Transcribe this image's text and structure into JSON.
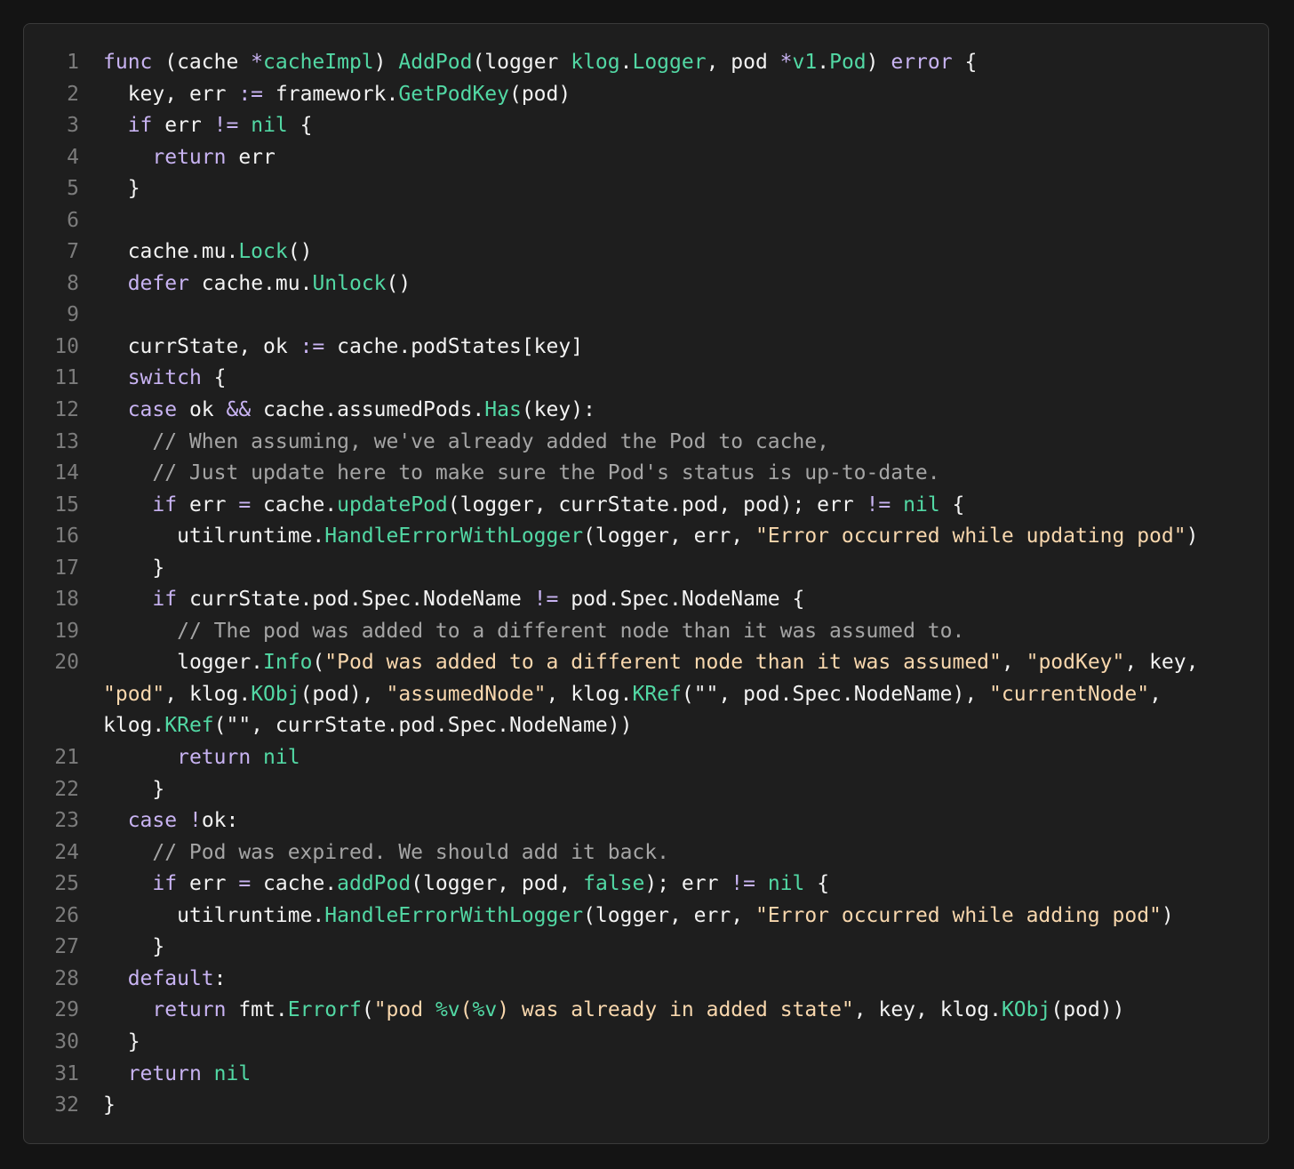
{
  "theme": {
    "background": "#141414",
    "panel_background": "#1e1e1e",
    "panel_border": "#3a3a3a",
    "line_number": "#7c7c7c",
    "plain": "#f3f3f3",
    "keyword": "#c8b3f2",
    "function": "#52d8a4",
    "string": "#f8d7ad",
    "comment": "#a5a5a5"
  },
  "code_lines": [
    {
      "number": "1",
      "tokens": [
        {
          "t": "func",
          "k": "kw"
        },
        {
          "t": " (cache "
        },
        {
          "t": "*",
          "k": "kw"
        },
        {
          "t": "cacheImpl",
          "k": "fn"
        },
        {
          "t": ") "
        },
        {
          "t": "AddPod",
          "k": "fn"
        },
        {
          "t": "(logger "
        },
        {
          "t": "klog",
          "k": "fn"
        },
        {
          "t": "."
        },
        {
          "t": "Logger",
          "k": "fn"
        },
        {
          "t": ", pod "
        },
        {
          "t": "*",
          "k": "kw"
        },
        {
          "t": "v1",
          "k": "fn"
        },
        {
          "t": "."
        },
        {
          "t": "Pod",
          "k": "fn"
        },
        {
          "t": ") "
        },
        {
          "t": "error",
          "k": "kw"
        },
        {
          "t": " {"
        }
      ]
    },
    {
      "number": "2",
      "tokens": [
        {
          "t": "  key, err "
        },
        {
          "t": ":=",
          "k": "kw"
        },
        {
          "t": " framework."
        },
        {
          "t": "GetPodKey",
          "k": "fn"
        },
        {
          "t": "(pod)"
        }
      ]
    },
    {
      "number": "3",
      "tokens": [
        {
          "t": "  "
        },
        {
          "t": "if",
          "k": "kw"
        },
        {
          "t": " err "
        },
        {
          "t": "!=",
          "k": "kw"
        },
        {
          "t": " "
        },
        {
          "t": "nil",
          "k": "fn"
        },
        {
          "t": " {"
        }
      ]
    },
    {
      "number": "4",
      "tokens": [
        {
          "t": "    "
        },
        {
          "t": "return",
          "k": "kw"
        },
        {
          "t": " err"
        }
      ]
    },
    {
      "number": "5",
      "tokens": [
        {
          "t": "  }"
        }
      ]
    },
    {
      "number": "6",
      "tokens": [
        {
          "t": ""
        }
      ]
    },
    {
      "number": "7",
      "tokens": [
        {
          "t": "  cache.mu."
        },
        {
          "t": "Lock",
          "k": "fn"
        },
        {
          "t": "()"
        }
      ]
    },
    {
      "number": "8",
      "tokens": [
        {
          "t": "  "
        },
        {
          "t": "defer",
          "k": "kw"
        },
        {
          "t": " cache.mu."
        },
        {
          "t": "Unlock",
          "k": "fn"
        },
        {
          "t": "()"
        }
      ]
    },
    {
      "number": "9",
      "tokens": [
        {
          "t": ""
        }
      ]
    },
    {
      "number": "10",
      "tokens": [
        {
          "t": "  currState, ok "
        },
        {
          "t": ":=",
          "k": "kw"
        },
        {
          "t": " cache.podStates[key]"
        }
      ]
    },
    {
      "number": "11",
      "tokens": [
        {
          "t": "  "
        },
        {
          "t": "switch",
          "k": "kw"
        },
        {
          "t": " {"
        }
      ]
    },
    {
      "number": "12",
      "tokens": [
        {
          "t": "  "
        },
        {
          "t": "case",
          "k": "kw"
        },
        {
          "t": " ok "
        },
        {
          "t": "&&",
          "k": "kw"
        },
        {
          "t": " cache.assumedPods."
        },
        {
          "t": "Has",
          "k": "fn"
        },
        {
          "t": "(key):"
        }
      ]
    },
    {
      "number": "13",
      "tokens": [
        {
          "t": "    "
        },
        {
          "t": "// When assuming, we've already added the Pod to cache,",
          "k": "cm"
        }
      ]
    },
    {
      "number": "14",
      "tokens": [
        {
          "t": "    "
        },
        {
          "t": "// Just update here to make sure the Pod's status is up-to-date.",
          "k": "cm"
        }
      ]
    },
    {
      "number": "15",
      "tokens": [
        {
          "t": "    "
        },
        {
          "t": "if",
          "k": "kw"
        },
        {
          "t": " err "
        },
        {
          "t": "=",
          "k": "kw"
        },
        {
          "t": " cache."
        },
        {
          "t": "updatePod",
          "k": "fn"
        },
        {
          "t": "(logger, currState.pod, pod); err "
        },
        {
          "t": "!=",
          "k": "kw"
        },
        {
          "t": " "
        },
        {
          "t": "nil",
          "k": "fn"
        },
        {
          "t": " {"
        }
      ]
    },
    {
      "number": "16",
      "tokens": [
        {
          "t": "      utilruntime."
        },
        {
          "t": "HandleErrorWithLogger",
          "k": "fn"
        },
        {
          "t": "(logger, err, "
        },
        {
          "t": "\"Error occurred while updating pod\"",
          "k": "str"
        },
        {
          "t": ")"
        }
      ]
    },
    {
      "number": "17",
      "tokens": [
        {
          "t": "    }"
        }
      ]
    },
    {
      "number": "18",
      "tokens": [
        {
          "t": "    "
        },
        {
          "t": "if",
          "k": "kw"
        },
        {
          "t": " currState.pod.Spec.NodeName "
        },
        {
          "t": "!=",
          "k": "kw"
        },
        {
          "t": " pod.Spec.NodeName {"
        }
      ]
    },
    {
      "number": "19",
      "tokens": [
        {
          "t": "      "
        },
        {
          "t": "// The pod was added to a different node than it was assumed to.",
          "k": "cm"
        }
      ]
    },
    {
      "number": "20",
      "tokens": [
        {
          "t": "      logger."
        },
        {
          "t": "Info",
          "k": "fn"
        },
        {
          "t": "("
        },
        {
          "t": "\"Pod was added to a different node than it was assumed\"",
          "k": "str"
        },
        {
          "t": ", "
        },
        {
          "t": "\"podKey\"",
          "k": "str"
        },
        {
          "t": ", key, "
        },
        {
          "t": "\"pod\"",
          "k": "str"
        },
        {
          "t": ", klog."
        },
        {
          "t": "KObj",
          "k": "fn"
        },
        {
          "t": "(pod), "
        },
        {
          "t": "\"assumedNode\"",
          "k": "str"
        },
        {
          "t": ", klog."
        },
        {
          "t": "KRef",
          "k": "fn"
        },
        {
          "t": "(\"\", pod.Spec.NodeName), "
        },
        {
          "t": "\"currentNode\"",
          "k": "str"
        },
        {
          "t": ", klog."
        },
        {
          "t": "KRef",
          "k": "fn"
        },
        {
          "t": "(\"\", currState.pod.Spec.NodeName))"
        }
      ]
    },
    {
      "number": "21",
      "tokens": [
        {
          "t": "      "
        },
        {
          "t": "return",
          "k": "kw"
        },
        {
          "t": " "
        },
        {
          "t": "nil",
          "k": "fn"
        }
      ]
    },
    {
      "number": "22",
      "tokens": [
        {
          "t": "    }"
        }
      ]
    },
    {
      "number": "23",
      "tokens": [
        {
          "t": "  "
        },
        {
          "t": "case",
          "k": "kw"
        },
        {
          "t": " "
        },
        {
          "t": "!",
          "k": "kw"
        },
        {
          "t": "ok:"
        }
      ]
    },
    {
      "number": "24",
      "tokens": [
        {
          "t": "    "
        },
        {
          "t": "// Pod was expired. We should add it back.",
          "k": "cm"
        }
      ]
    },
    {
      "number": "25",
      "tokens": [
        {
          "t": "    "
        },
        {
          "t": "if",
          "k": "kw"
        },
        {
          "t": " err "
        },
        {
          "t": "=",
          "k": "kw"
        },
        {
          "t": " cache."
        },
        {
          "t": "addPod",
          "k": "fn"
        },
        {
          "t": "(logger, pod, "
        },
        {
          "t": "false",
          "k": "fn"
        },
        {
          "t": "); err "
        },
        {
          "t": "!=",
          "k": "kw"
        },
        {
          "t": " "
        },
        {
          "t": "nil",
          "k": "fn"
        },
        {
          "t": " {"
        }
      ]
    },
    {
      "number": "26",
      "tokens": [
        {
          "t": "      utilruntime."
        },
        {
          "t": "HandleErrorWithLogger",
          "k": "fn"
        },
        {
          "t": "(logger, err, "
        },
        {
          "t": "\"Error occurred while adding pod\"",
          "k": "str"
        },
        {
          "t": ")"
        }
      ]
    },
    {
      "number": "27",
      "tokens": [
        {
          "t": "    }"
        }
      ]
    },
    {
      "number": "28",
      "tokens": [
        {
          "t": "  "
        },
        {
          "t": "default",
          "k": "kw"
        },
        {
          "t": ":"
        }
      ]
    },
    {
      "number": "29",
      "tokens": [
        {
          "t": "    "
        },
        {
          "t": "return",
          "k": "kw"
        },
        {
          "t": " fmt."
        },
        {
          "t": "Errorf",
          "k": "fn"
        },
        {
          "t": "("
        },
        {
          "t": "\"pod ",
          "k": "str"
        },
        {
          "t": "%v",
          "k": "fn"
        },
        {
          "t": "(",
          "k": "str"
        },
        {
          "t": "%v",
          "k": "fn"
        },
        {
          "t": ") was already in added state\"",
          "k": "str"
        },
        {
          "t": ", key, klog."
        },
        {
          "t": "KObj",
          "k": "fn"
        },
        {
          "t": "(pod))"
        }
      ]
    },
    {
      "number": "30",
      "tokens": [
        {
          "t": "  }"
        }
      ]
    },
    {
      "number": "31",
      "tokens": [
        {
          "t": "  "
        },
        {
          "t": "return",
          "k": "kw"
        },
        {
          "t": " "
        },
        {
          "t": "nil",
          "k": "fn"
        }
      ]
    },
    {
      "number": "32",
      "tokens": [
        {
          "t": "}"
        }
      ]
    }
  ]
}
